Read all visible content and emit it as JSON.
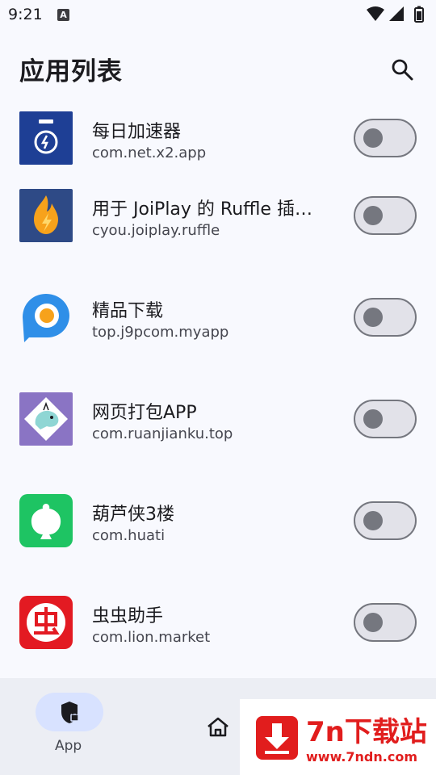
{
  "status_bar": {
    "time": "9:21",
    "keyboard_badge": "A",
    "icons": [
      "wifi-icon",
      "signal-icon",
      "battery-icon"
    ]
  },
  "app_bar": {
    "title": "应用列表",
    "search_icon": "search-icon"
  },
  "apps": [
    {
      "name": "每日加速器",
      "package": "com.net.x2.app",
      "enabled": false,
      "icon": "speedometer-icon",
      "icon_color": "#1e3f95"
    },
    {
      "name": "用于 JoiPlay 的 Ruffle 插…",
      "package": "cyou.joiplay.ruffle",
      "enabled": false,
      "icon": "flame-icon",
      "icon_color": "#2e4a86"
    },
    {
      "name": "精品下载",
      "package": "top.j9pcom.myapp",
      "enabled": false,
      "icon": "p-logo-icon",
      "icon_color": "#2f8fe8"
    },
    {
      "name": "网页打包APP",
      "package": "com.ruanjianku.top",
      "enabled": false,
      "icon": "dinosaur-icon",
      "icon_color": "#8a74c4"
    },
    {
      "name": "葫芦侠3楼",
      "package": "com.huati",
      "enabled": false,
      "icon": "gourd-icon",
      "icon_color": "#1ec463"
    },
    {
      "name": "虫虫助手",
      "package": "com.lion.market",
      "enabled": false,
      "icon": "bug-logo-icon",
      "icon_color": "#e31a22"
    }
  ],
  "bottom_nav": {
    "items": [
      {
        "label": "App",
        "icon": "shield-lock-icon",
        "selected": true
      },
      {
        "label": "",
        "icon": "home-icon",
        "selected": false
      }
    ]
  },
  "watermark": {
    "title": "7n下载站",
    "url": "www.7ndn.com"
  },
  "colors": {
    "background": "#f8f9fe",
    "nav_background": "#eceef4",
    "nav_indicator": "#d8e2ff",
    "toggle_outline": "#75777f",
    "watermark_red": "#e11d1d"
  }
}
